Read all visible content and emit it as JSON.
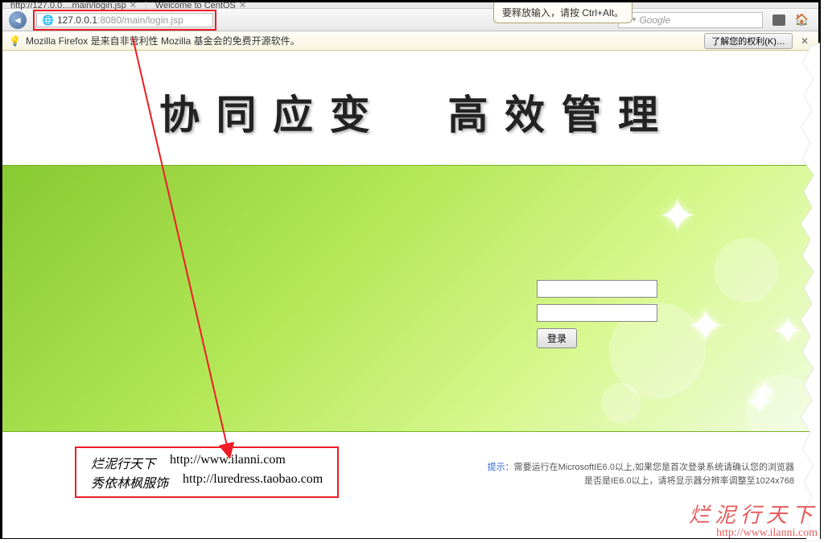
{
  "browser": {
    "tabs": [
      {
        "title": "http://127.0.0....main/login.jsp"
      },
      {
        "title": "Welcome to CentOS"
      }
    ],
    "tooltip": "要释放输入，请按 Ctrl+Alt。",
    "url_prefix": "127.0.0.1",
    "url_port": ":8080",
    "url_path": "/main/login.jsp",
    "search_placeholder": "Google",
    "info_bar_text": "Mozilla Firefox 是来自非营利性 Mozilla 基金会的免费开源软件。",
    "rights_button": "了解您的权利(K)…"
  },
  "page": {
    "slogan_left": "协 同 应 变",
    "slogan_right": "高 效 管 理",
    "login_button": "登录"
  },
  "footer": {
    "row1_label": "烂泥行天下",
    "row1_url": "http://www.ilanni.com",
    "row2_label": "秀依林枫服饰",
    "row2_url": "http://luredress.taobao.com"
  },
  "hint": {
    "prefix": "提示：",
    "line1": "需要运行在MicrosoftIE6.0以上,如果您是首次登录系统请确认您的浏览器",
    "line2": "是否是IE6.0以上，请将显示器分辨率调整至1024x768"
  },
  "watermark": {
    "text": "烂泥行天下",
    "url": "http://www.ilanni.com"
  }
}
